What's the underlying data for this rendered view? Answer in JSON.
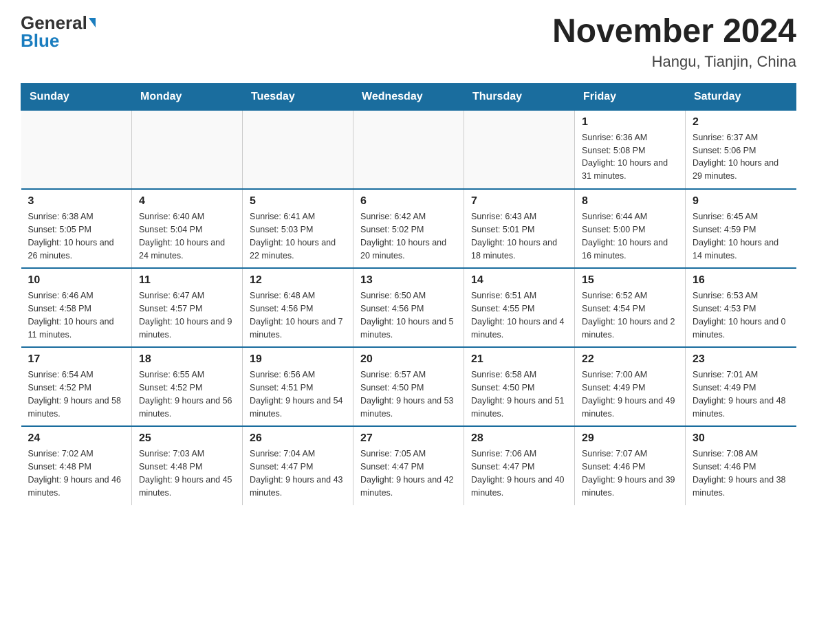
{
  "logo": {
    "general": "General",
    "blue": "Blue"
  },
  "title": "November 2024",
  "location": "Hangu, Tianjin, China",
  "days_of_week": [
    "Sunday",
    "Monday",
    "Tuesday",
    "Wednesday",
    "Thursday",
    "Friday",
    "Saturday"
  ],
  "weeks": [
    [
      {
        "day": "",
        "info": ""
      },
      {
        "day": "",
        "info": ""
      },
      {
        "day": "",
        "info": ""
      },
      {
        "day": "",
        "info": ""
      },
      {
        "day": "",
        "info": ""
      },
      {
        "day": "1",
        "info": "Sunrise: 6:36 AM\nSunset: 5:08 PM\nDaylight: 10 hours and 31 minutes."
      },
      {
        "day": "2",
        "info": "Sunrise: 6:37 AM\nSunset: 5:06 PM\nDaylight: 10 hours and 29 minutes."
      }
    ],
    [
      {
        "day": "3",
        "info": "Sunrise: 6:38 AM\nSunset: 5:05 PM\nDaylight: 10 hours and 26 minutes."
      },
      {
        "day": "4",
        "info": "Sunrise: 6:40 AM\nSunset: 5:04 PM\nDaylight: 10 hours and 24 minutes."
      },
      {
        "day": "5",
        "info": "Sunrise: 6:41 AM\nSunset: 5:03 PM\nDaylight: 10 hours and 22 minutes."
      },
      {
        "day": "6",
        "info": "Sunrise: 6:42 AM\nSunset: 5:02 PM\nDaylight: 10 hours and 20 minutes."
      },
      {
        "day": "7",
        "info": "Sunrise: 6:43 AM\nSunset: 5:01 PM\nDaylight: 10 hours and 18 minutes."
      },
      {
        "day": "8",
        "info": "Sunrise: 6:44 AM\nSunset: 5:00 PM\nDaylight: 10 hours and 16 minutes."
      },
      {
        "day": "9",
        "info": "Sunrise: 6:45 AM\nSunset: 4:59 PM\nDaylight: 10 hours and 14 minutes."
      }
    ],
    [
      {
        "day": "10",
        "info": "Sunrise: 6:46 AM\nSunset: 4:58 PM\nDaylight: 10 hours and 11 minutes."
      },
      {
        "day": "11",
        "info": "Sunrise: 6:47 AM\nSunset: 4:57 PM\nDaylight: 10 hours and 9 minutes."
      },
      {
        "day": "12",
        "info": "Sunrise: 6:48 AM\nSunset: 4:56 PM\nDaylight: 10 hours and 7 minutes."
      },
      {
        "day": "13",
        "info": "Sunrise: 6:50 AM\nSunset: 4:56 PM\nDaylight: 10 hours and 5 minutes."
      },
      {
        "day": "14",
        "info": "Sunrise: 6:51 AM\nSunset: 4:55 PM\nDaylight: 10 hours and 4 minutes."
      },
      {
        "day": "15",
        "info": "Sunrise: 6:52 AM\nSunset: 4:54 PM\nDaylight: 10 hours and 2 minutes."
      },
      {
        "day": "16",
        "info": "Sunrise: 6:53 AM\nSunset: 4:53 PM\nDaylight: 10 hours and 0 minutes."
      }
    ],
    [
      {
        "day": "17",
        "info": "Sunrise: 6:54 AM\nSunset: 4:52 PM\nDaylight: 9 hours and 58 minutes."
      },
      {
        "day": "18",
        "info": "Sunrise: 6:55 AM\nSunset: 4:52 PM\nDaylight: 9 hours and 56 minutes."
      },
      {
        "day": "19",
        "info": "Sunrise: 6:56 AM\nSunset: 4:51 PM\nDaylight: 9 hours and 54 minutes."
      },
      {
        "day": "20",
        "info": "Sunrise: 6:57 AM\nSunset: 4:50 PM\nDaylight: 9 hours and 53 minutes."
      },
      {
        "day": "21",
        "info": "Sunrise: 6:58 AM\nSunset: 4:50 PM\nDaylight: 9 hours and 51 minutes."
      },
      {
        "day": "22",
        "info": "Sunrise: 7:00 AM\nSunset: 4:49 PM\nDaylight: 9 hours and 49 minutes."
      },
      {
        "day": "23",
        "info": "Sunrise: 7:01 AM\nSunset: 4:49 PM\nDaylight: 9 hours and 48 minutes."
      }
    ],
    [
      {
        "day": "24",
        "info": "Sunrise: 7:02 AM\nSunset: 4:48 PM\nDaylight: 9 hours and 46 minutes."
      },
      {
        "day": "25",
        "info": "Sunrise: 7:03 AM\nSunset: 4:48 PM\nDaylight: 9 hours and 45 minutes."
      },
      {
        "day": "26",
        "info": "Sunrise: 7:04 AM\nSunset: 4:47 PM\nDaylight: 9 hours and 43 minutes."
      },
      {
        "day": "27",
        "info": "Sunrise: 7:05 AM\nSunset: 4:47 PM\nDaylight: 9 hours and 42 minutes."
      },
      {
        "day": "28",
        "info": "Sunrise: 7:06 AM\nSunset: 4:47 PM\nDaylight: 9 hours and 40 minutes."
      },
      {
        "day": "29",
        "info": "Sunrise: 7:07 AM\nSunset: 4:46 PM\nDaylight: 9 hours and 39 minutes."
      },
      {
        "day": "30",
        "info": "Sunrise: 7:08 AM\nSunset: 4:46 PM\nDaylight: 9 hours and 38 minutes."
      }
    ]
  ]
}
